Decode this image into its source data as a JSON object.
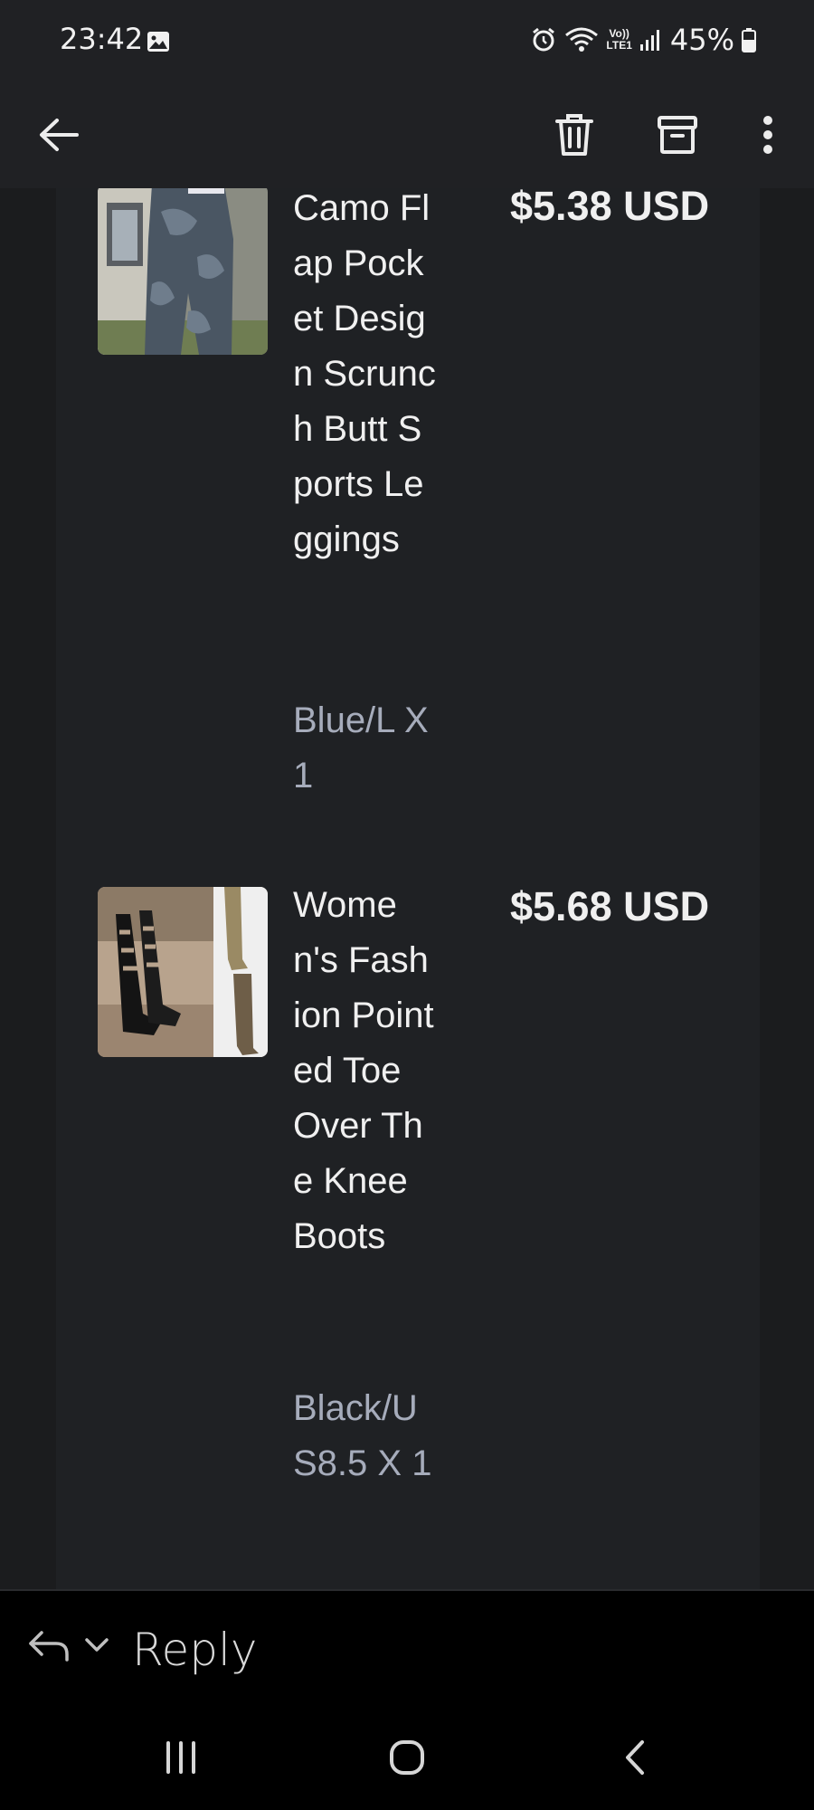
{
  "status_bar": {
    "time": "23:42",
    "battery": "45%",
    "icons": [
      "gallery-icon",
      "alarm-icon",
      "wifi-icon",
      "volte-icon",
      "signal-icon",
      "battery-icon"
    ],
    "volte_line1": "Vo))",
    "volte_line2": "LTE1"
  },
  "app_bar": {
    "icons": [
      "back-arrow-icon",
      "delete-icon",
      "archive-icon",
      "more-vert-icon"
    ]
  },
  "items": [
    {
      "title": "Camo Flap Pocket Design Scrunch Butt Sports Leggings",
      "variant": "Blue/L X 1",
      "price": "$5.38 USD"
    },
    {
      "title": "Women's Fashion Pointed Toe Over The Knee Boots",
      "variant": "Black/US8.5 X 1",
      "price": "$5.68 USD"
    }
  ],
  "reply_bar": {
    "label": "Reply"
  },
  "nav_bar": {
    "icons": [
      "recents-icon",
      "home-icon",
      "back-icon"
    ]
  },
  "colors": {
    "background": "#1b1c1e",
    "card": "#1f2124",
    "bars": "#202124",
    "variant_text": "#a6acbb"
  }
}
